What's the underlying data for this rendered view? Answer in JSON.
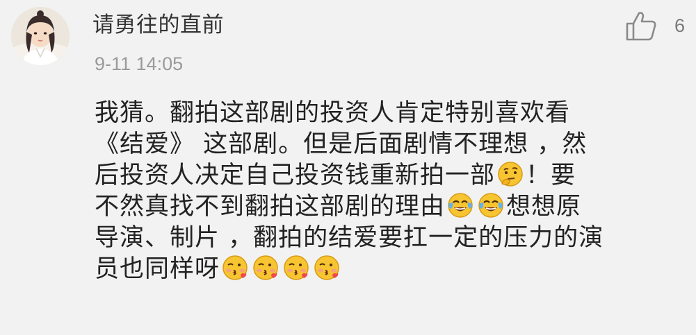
{
  "comment": {
    "username": "请勇往的直前",
    "timestamp": "9-11 14:05",
    "like_count": "6",
    "avatar_icon": "avatar-illustration",
    "like_icon": "thumbs-up-icon",
    "text_lines": [
      [
        "我猜。翻拍这部剧的投资人肯定特别喜欢看"
      ],
      [
        "《结爱》 这部剧。但是后面剧情不理想 ，然"
      ],
      [
        "后投资人决定自己投资钱重新拍一部",
        "{thinking}",
        "！要"
      ],
      [
        "不然真找不到翻拍这部剧的理由",
        "{crying-laughing}",
        "{crying-laughing}",
        "想想原"
      ],
      [
        "导演、制片 ，翻拍的结爱要扛一定的压力的演"
      ],
      [
        "员也同样呀",
        "{kissing}",
        "{kissing}",
        "{kissing}",
        "{kissing}"
      ]
    ]
  },
  "colors": {
    "background": "#f2f2f2",
    "username": "#333333",
    "timestamp": "#9a9a9a",
    "content": "#222222",
    "icon": "#8a8a8a",
    "emoji_yellow": "#f7c531"
  }
}
